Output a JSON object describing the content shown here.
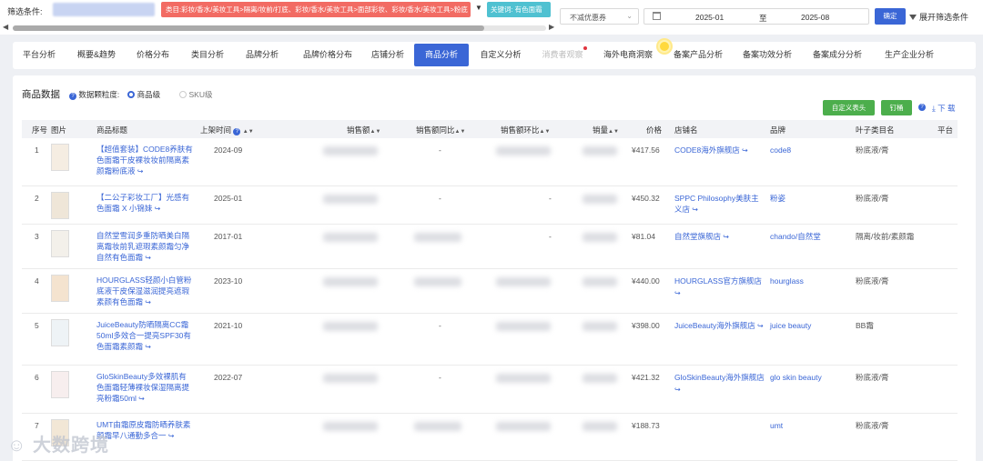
{
  "filter": {
    "label": "筛选条件:",
    "category_tag": "类目:彩妆/香水/美妆工具>隔离/妆前/打底、彩妆/香水/美妆工具>面部彩妆、彩妆/香水/美妆工具>粉底",
    "keyword_tag": "关键词: 有色面霜",
    "coupon_select": "不减优惠券",
    "date_from": "2025-01",
    "date_sep": "至",
    "date_to": "2025-08",
    "confirm_label": "确定",
    "expand_label": "展开筛选条件"
  },
  "tabs": [
    {
      "label": "平台分析",
      "state": "normal"
    },
    {
      "label": "概要&趋势",
      "state": "normal"
    },
    {
      "label": "价格分布",
      "state": "normal"
    },
    {
      "label": "类目分析",
      "state": "normal"
    },
    {
      "label": "品牌分析",
      "state": "normal"
    },
    {
      "label": "品牌价格分布",
      "state": "normal"
    },
    {
      "label": "店铺分析",
      "state": "normal"
    },
    {
      "label": "商品分析",
      "state": "active"
    },
    {
      "label": "自定义分析",
      "state": "normal"
    },
    {
      "label": "消费者观察",
      "state": "dim"
    },
    {
      "label": "海外电商洞察",
      "state": "normal"
    },
    {
      "label": "备案产品分析",
      "state": "normal"
    },
    {
      "label": "备案功效分析",
      "state": "normal"
    },
    {
      "label": "备案成分分析",
      "state": "normal"
    },
    {
      "label": "生产企业分析",
      "state": "normal"
    }
  ],
  "panel": {
    "title": "商品数据",
    "granularity_label": "数据颗粒度:",
    "option_product": "商品级",
    "option_sku": "SKU级",
    "custom_header_btn": "自定义表头",
    "pin_btn": "钉桶",
    "download_label": "下 载"
  },
  "table": {
    "headers": {
      "index": "序号",
      "image": "图片",
      "title": "商品标题",
      "launch": "上架时间",
      "sales": "销售额",
      "sales_yoy": "销售额同比",
      "sales_mom": "销售额环比",
      "volume": "销量",
      "price": "价格",
      "shop": "店铺名",
      "brand": "品牌",
      "leaf": "叶子类目名",
      "platform": "平台"
    },
    "rows": [
      {
        "index": "1",
        "title": "【超值套装】CODE8养肤有色面霜干皮裸妆妆前隔离素颜霜粉底液",
        "launch": "2024-09",
        "sales_yoy": "-",
        "price": "¥417.56",
        "shop": "CODE8海外旗舰店",
        "brand": "code8",
        "leaf": "粉底液/膏"
      },
      {
        "index": "2",
        "title": "【二公子彩妆工厂】光感有色面霜 X 小锦妹",
        "launch": "2025-01",
        "sales_yoy": "-",
        "sales_mom": "-",
        "price": "¥450.32",
        "shop": "SPPC Philosophy美肤主义店",
        "brand": "粉姿",
        "leaf": "粉底液/膏"
      },
      {
        "index": "3",
        "title": "自然堂雪润多重防晒美白隔离霜妆前乳遮瑕素颜霜匀净自然有色面霜",
        "launch": "2017-01",
        "sales_mom": "-",
        "price": "¥81.04",
        "shop": "自然堂旗舰店",
        "brand": "chando/自然堂",
        "leaf": "隔离/妆前/素颜霜"
      },
      {
        "index": "4",
        "title": "HOURGLASS轻颜小白管粉底液干皮保湿滋润提亮遮瑕素颜有色面霜",
        "launch": "2023-10",
        "price": "¥440.00",
        "shop": "HOURGLASS官方旗舰店",
        "brand": "hourglass",
        "leaf": "粉底液/膏"
      },
      {
        "index": "5",
        "title": "JuiceBeauty防晒隔离CC霜50ml多效合一提亮SPF30有色面霜素颜霜",
        "launch": "2021-10",
        "sales_yoy": "-",
        "price": "¥398.00",
        "shop": "JuiceBeauty海外旗舰店",
        "brand": "juice beauty",
        "leaf": "BB霜"
      },
      {
        "index": "6",
        "title": "GloSkinBeauty多效裸肌有色面霜轻薄裸妆保湿隔离提亮粉霜50ml",
        "launch": "2022-07",
        "sales_yoy": "-",
        "price": "¥421.32",
        "shop": "GloSkinBeauty海外旗舰店",
        "brand": "glo skin beauty",
        "leaf": "粉底液/膏"
      },
      {
        "index": "7",
        "title": "UMT由霜原皮霜防晒养肤素颜霜早八通勤多合一",
        "launch": "",
        "price": "¥188.73",
        "shop": "",
        "brand": "umt",
        "leaf": "粉底液/膏"
      }
    ]
  },
  "watermark": "大数跨境"
}
